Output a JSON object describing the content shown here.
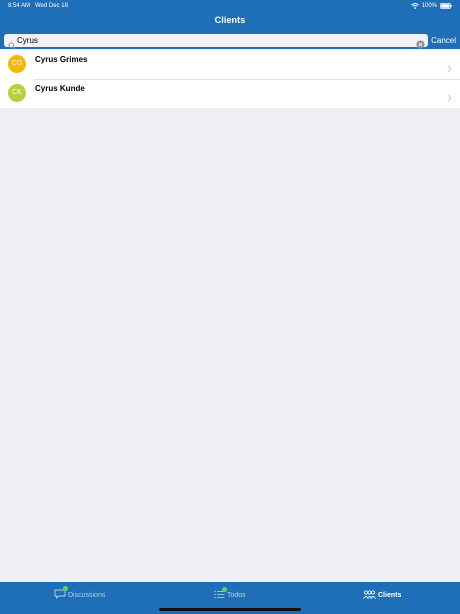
{
  "status": {
    "time": "8:54 AM",
    "date": "Wed Dec 18",
    "battery": "100%"
  },
  "nav": {
    "title": "Clients"
  },
  "search": {
    "value": "Cyrus",
    "cancel_label": "Cancel"
  },
  "clients": [
    {
      "initials": "CG",
      "name": "Cyrus Grimes",
      "color": "#f5b800"
    },
    {
      "initials": "CK",
      "name": "Cyrus Kunde",
      "color": "#b5d23a"
    }
  ],
  "tabs": [
    {
      "label": "Discussions",
      "icon": "chat-bubble-icon",
      "badge": true,
      "active": false
    },
    {
      "label": "Todos",
      "icon": "list-icon",
      "badge": true,
      "active": false
    },
    {
      "label": "Clients",
      "icon": "people-icon",
      "badge": false,
      "active": true
    }
  ],
  "colors": {
    "brand": "#1f6fb8",
    "background": "#efeff4",
    "badge": "#5fd35f"
  }
}
